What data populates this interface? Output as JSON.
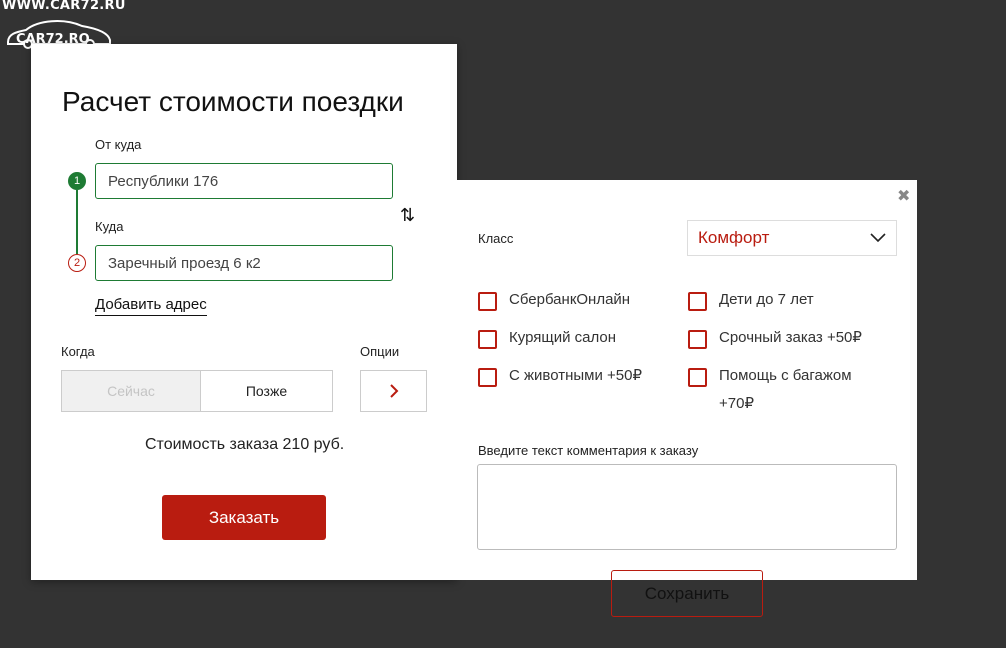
{
  "watermark": {
    "url": "WWW.CAR72.RU",
    "logo_text": "CAR72.RO"
  },
  "calculator": {
    "title": "Расчет стоимости поездки",
    "from_label": "От куда",
    "from_value": "Республики 176",
    "to_label": "Куда",
    "to_value": "Заречный проезд 6 к2",
    "step1": "1",
    "step2": "2",
    "swap_icon": "⇅",
    "add_address": "Добавить адрес",
    "when_label": "Когда",
    "now_label": "Сейчас",
    "later_label": "Позже",
    "options_label": "Опции",
    "cost_text": "Стоимость заказа 210 руб.",
    "order_button": "Заказать"
  },
  "options_panel": {
    "close_icon": "✖",
    "class_label": "Класс",
    "class_value": "Комфорт",
    "checkboxes": [
      "СбербанкОнлайн",
      "Дети до 7 лет",
      "Курящий салон",
      "Срочный заказ +50₽",
      "С животными +50₽",
      "Помощь с багажом +70₽"
    ],
    "comment_label": "Введите текст комментария к заказу",
    "save_button": "Сохранить"
  },
  "colors": {
    "accent": "#b91c10",
    "green": "#1e7b34",
    "background": "#333333"
  }
}
